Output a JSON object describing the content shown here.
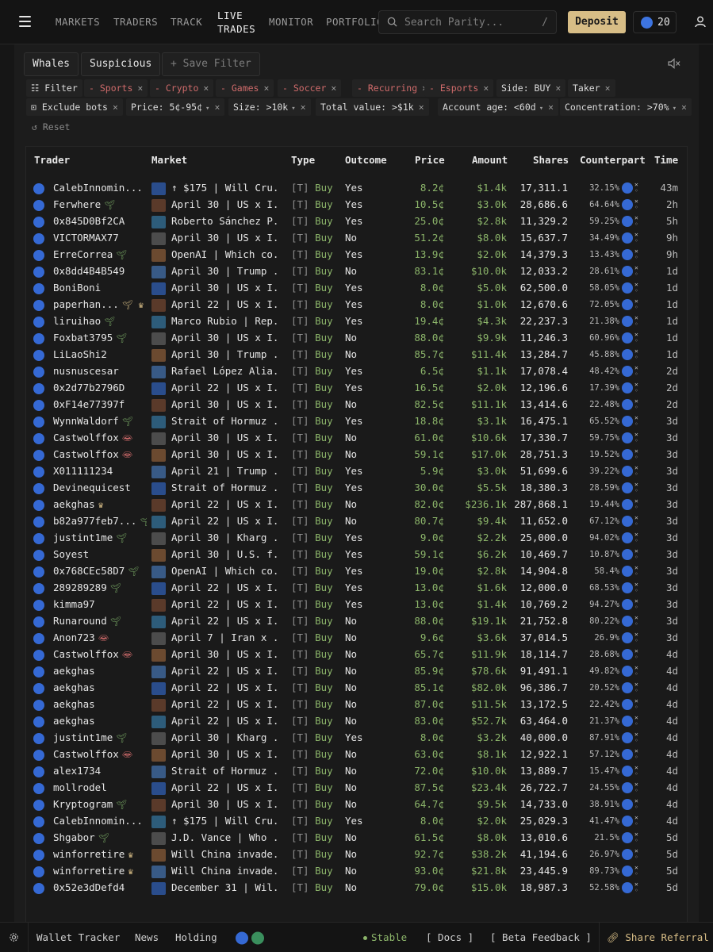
{
  "nav": {
    "links": [
      "MARKETS",
      "TRADERS",
      "TRACK",
      "LIVE TRADES",
      "MONITOR",
      "PORTFOLIO"
    ],
    "active": "LIVE TRADES",
    "search_placeholder": "Search Parity...",
    "search_shortcut": "/",
    "deposit_label": "Deposit",
    "points": "20"
  },
  "tabs": {
    "whales": "Whales",
    "suspicious": "Suspicious",
    "save_filter": "+ Save Filter"
  },
  "filters": {
    "filter_label": "Filter",
    "excluded": [
      "- Sports",
      "- Crypto",
      "- Games",
      "- Soccer",
      "- Recurring",
      "- Esports"
    ],
    "side": "Side: BUY",
    "taker": "Taker",
    "exclude_bots": "Exclude bots",
    "price": "Price: 5¢-95¢",
    "size": "Size: >10k",
    "total_value": "Total value: >$1k",
    "account_age": "Account age: <60d",
    "concentration": "Concentration: >70%",
    "reset": "Reset",
    "close_glyph": "×",
    "dropdown_glyph": "▾"
  },
  "columns": [
    "Trader",
    "Market",
    "Type",
    "Outcome",
    "Price",
    "Amount",
    "Shares",
    "Counterpart",
    "Time"
  ],
  "type_prefix": "[T]",
  "type_value": "Buy",
  "trades": [
    {
      "trader": "CalebInnomin...",
      "badge": "",
      "market": "↑ $175 | Will Cru...",
      "outcome": "Yes",
      "price": "8.2¢",
      "amount": "$1.4k",
      "shares": "17,311.1",
      "cp": "32.15%",
      "time": "43m"
    },
    {
      "trader": "Ferwhere",
      "badge": "sprout",
      "market": "April 30 | US x I...",
      "outcome": "Yes",
      "price": "10.5¢",
      "amount": "$3.0k",
      "shares": "28,686.6",
      "cp": "64.64%",
      "time": "2h"
    },
    {
      "trader": "0x845D0Bf2CA",
      "badge": "",
      "market": "Roberto Sánchez P...",
      "outcome": "Yes",
      "price": "25.0¢",
      "amount": "$2.8k",
      "shares": "11,329.2",
      "cp": "59.25%",
      "time": "5h"
    },
    {
      "trader": "VICTORMAX77",
      "badge": "",
      "market": "April 30 | US x I...",
      "outcome": "No",
      "price": "51.2¢",
      "amount": "$8.0k",
      "shares": "15,637.7",
      "cp": "34.49%",
      "time": "9h"
    },
    {
      "trader": "ErreCorrea",
      "badge": "sprout",
      "market": "OpenAI | Which co...",
      "outcome": "Yes",
      "price": "13.9¢",
      "amount": "$2.0k",
      "shares": "14,379.3",
      "cp": "13.43%",
      "time": "9h"
    },
    {
      "trader": "0x8dd4B4B549",
      "badge": "",
      "market": "April 30 | Trump ...",
      "outcome": "No",
      "price": "83.1¢",
      "amount": "$10.0k",
      "shares": "12,033.2",
      "cp": "28.61%",
      "time": "1d"
    },
    {
      "trader": "BoniBoni",
      "badge": "",
      "market": "April 30 | US x I...",
      "outcome": "Yes",
      "price": "8.0¢",
      "amount": "$5.0k",
      "shares": "62,500.0",
      "cp": "58.05%",
      "time": "1d"
    },
    {
      "trader": "paperhan...",
      "badge": "sprout-crown",
      "market": "April 22 | US x I...",
      "outcome": "Yes",
      "price": "8.0¢",
      "amount": "$1.0k",
      "shares": "12,670.6",
      "cp": "72.05%",
      "time": "1d"
    },
    {
      "trader": "liruihao",
      "badge": "sprout",
      "market": "Marco Rubio | Rep...",
      "outcome": "Yes",
      "price": "19.4¢",
      "amount": "$4.3k",
      "shares": "22,237.3",
      "cp": "21.38%",
      "time": "1d"
    },
    {
      "trader": "Foxbat3795",
      "badge": "sprout",
      "market": "April 30 | US x I...",
      "outcome": "No",
      "price": "88.0¢",
      "amount": "$9.9k",
      "shares": "11,246.3",
      "cp": "60.96%",
      "time": "1d"
    },
    {
      "trader": "LiLaoShi2",
      "badge": "",
      "market": "April 30 | Trump ...",
      "outcome": "No",
      "price": "85.7¢",
      "amount": "$11.4k",
      "shares": "13,284.7",
      "cp": "45.88%",
      "time": "1d"
    },
    {
      "trader": "nusnuscesar",
      "badge": "",
      "market": "Rafael López Alia...",
      "outcome": "Yes",
      "price": "6.5¢",
      "amount": "$1.1k",
      "shares": "17,078.4",
      "cp": "48.42%",
      "time": "2d"
    },
    {
      "trader": "0x2d77b2796D",
      "badge": "",
      "market": "April 22 | US x I...",
      "outcome": "Yes",
      "price": "16.5¢",
      "amount": "$2.0k",
      "shares": "12,196.6",
      "cp": "17.39%",
      "time": "2d"
    },
    {
      "trader": "0xF14e77397f",
      "badge": "",
      "market": "April 30 | US x I...",
      "outcome": "No",
      "price": "82.5¢",
      "amount": "$11.1k",
      "shares": "13,414.6",
      "cp": "22.48%",
      "time": "2d"
    },
    {
      "trader": "WynnWaldorf",
      "badge": "sprout",
      "market": "Strait of Hormuz ...",
      "outcome": "Yes",
      "price": "18.8¢",
      "amount": "$3.1k",
      "shares": "16,475.1",
      "cp": "65.52%",
      "time": "3d"
    },
    {
      "trader": "Castwolffox",
      "badge": "lips",
      "market": "April 30 | US x I...",
      "outcome": "No",
      "price": "61.0¢",
      "amount": "$10.6k",
      "shares": "17,330.7",
      "cp": "59.75%",
      "time": "3d"
    },
    {
      "trader": "Castwolffox",
      "badge": "lips",
      "market": "April 30 | US x I...",
      "outcome": "No",
      "price": "59.1¢",
      "amount": "$17.0k",
      "shares": "28,751.3",
      "cp": "19.52%",
      "time": "3d"
    },
    {
      "trader": "X011111234",
      "badge": "",
      "market": "April 21 | Trump ...",
      "outcome": "Yes",
      "price": "5.9¢",
      "amount": "$3.0k",
      "shares": "51,699.6",
      "cp": "39.22%",
      "time": "3d"
    },
    {
      "trader": "Devinequicest",
      "badge": "",
      "market": "Strait of Hormuz ...",
      "outcome": "Yes",
      "price": "30.0¢",
      "amount": "$5.5k",
      "shares": "18,380.3",
      "cp": "28.59%",
      "time": "3d"
    },
    {
      "trader": "aekghas",
      "badge": "crown",
      "market": "April 22 | US x I...",
      "outcome": "No",
      "price": "82.0¢",
      "amount": "$236.1k",
      "shares": "287,868.1",
      "cp": "19.44%",
      "time": "3d"
    },
    {
      "trader": "b82a977feb7...",
      "badge": "sprout",
      "market": "April 22 | US x I...",
      "outcome": "No",
      "price": "80.7¢",
      "amount": "$9.4k",
      "shares": "11,652.0",
      "cp": "67.12%",
      "time": "3d"
    },
    {
      "trader": "justint1me",
      "badge": "sprout",
      "market": "April 30 | Kharg ...",
      "outcome": "Yes",
      "price": "9.0¢",
      "amount": "$2.2k",
      "shares": "25,000.0",
      "cp": "94.02%",
      "time": "3d"
    },
    {
      "trader": "Soyest",
      "badge": "",
      "market": "April 30 | U.S. f...",
      "outcome": "Yes",
      "price": "59.1¢",
      "amount": "$6.2k",
      "shares": "10,469.7",
      "cp": "10.87%",
      "time": "3d"
    },
    {
      "trader": "0x768CEc58D7",
      "badge": "sprout",
      "market": "OpenAI | Which co...",
      "outcome": "Yes",
      "price": "19.0¢",
      "amount": "$2.8k",
      "shares": "14,904.8",
      "cp": "58.4%",
      "time": "3d"
    },
    {
      "trader": "289289289",
      "badge": "sprout",
      "market": "April 22 | US x I...",
      "outcome": "Yes",
      "price": "13.0¢",
      "amount": "$1.6k",
      "shares": "12,000.0",
      "cp": "68.53%",
      "time": "3d"
    },
    {
      "trader": "kimma97",
      "badge": "",
      "market": "April 22 | US x I...",
      "outcome": "Yes",
      "price": "13.0¢",
      "amount": "$1.4k",
      "shares": "10,769.2",
      "cp": "94.27%",
      "time": "3d"
    },
    {
      "trader": "Runaround",
      "badge": "sprout",
      "market": "April 22 | US x I...",
      "outcome": "No",
      "price": "88.0¢",
      "amount": "$19.1k",
      "shares": "21,752.8",
      "cp": "80.22%",
      "time": "3d"
    },
    {
      "trader": "Anon723",
      "badge": "lips",
      "market": "April 7 | Iran x ...",
      "outcome": "No",
      "price": "9.6¢",
      "amount": "$3.6k",
      "shares": "37,014.5",
      "cp": "26.9%",
      "time": "3d"
    },
    {
      "trader": "Castwolffox",
      "badge": "lips",
      "market": "April 30 | US x I...",
      "outcome": "No",
      "price": "65.7¢",
      "amount": "$11.9k",
      "shares": "18,114.7",
      "cp": "28.68%",
      "time": "4d"
    },
    {
      "trader": "aekghas",
      "badge": "",
      "market": "April 22 | US x I...",
      "outcome": "No",
      "price": "85.9¢",
      "amount": "$78.6k",
      "shares": "91,491.1",
      "cp": "49.82%",
      "time": "4d"
    },
    {
      "trader": "aekghas",
      "badge": "",
      "market": "April 22 | US x I...",
      "outcome": "No",
      "price": "85.1¢",
      "amount": "$82.0k",
      "shares": "96,386.7",
      "cp": "20.52%",
      "time": "4d"
    },
    {
      "trader": "aekghas",
      "badge": "",
      "market": "April 22 | US x I...",
      "outcome": "No",
      "price": "87.0¢",
      "amount": "$11.5k",
      "shares": "13,172.5",
      "cp": "22.42%",
      "time": "4d"
    },
    {
      "trader": "aekghas",
      "badge": "",
      "market": "April 22 | US x I...",
      "outcome": "No",
      "price": "83.0¢",
      "amount": "$52.7k",
      "shares": "63,464.0",
      "cp": "21.37%",
      "time": "4d"
    },
    {
      "trader": "justint1me",
      "badge": "sprout",
      "market": "April 30 | Kharg ...",
      "outcome": "Yes",
      "price": "8.0¢",
      "amount": "$3.2k",
      "shares": "40,000.0",
      "cp": "87.91%",
      "time": "4d"
    },
    {
      "trader": "Castwolffox",
      "badge": "lips",
      "market": "April 30 | US x I...",
      "outcome": "No",
      "price": "63.0¢",
      "amount": "$8.1k",
      "shares": "12,922.1",
      "cp": "57.12%",
      "time": "4d"
    },
    {
      "trader": "alex1734",
      "badge": "",
      "market": "Strait of Hormuz ...",
      "outcome": "No",
      "price": "72.0¢",
      "amount": "$10.0k",
      "shares": "13,889.7",
      "cp": "15.47%",
      "time": "4d"
    },
    {
      "trader": "mollrodel",
      "badge": "",
      "market": "April 22 | US x I...",
      "outcome": "No",
      "price": "87.5¢",
      "amount": "$23.4k",
      "shares": "26,722.7",
      "cp": "24.55%",
      "time": "4d"
    },
    {
      "trader": "Kryptogram",
      "badge": "sprout",
      "market": "April 30 | US x I...",
      "outcome": "No",
      "price": "64.7¢",
      "amount": "$9.5k",
      "shares": "14,733.0",
      "cp": "38.91%",
      "time": "4d"
    },
    {
      "trader": "CalebInnomin...",
      "badge": "",
      "market": "↑ $175 | Will Cru...",
      "outcome": "Yes",
      "price": "8.0¢",
      "amount": "$2.0k",
      "shares": "25,029.3",
      "cp": "41.47%",
      "time": "4d"
    },
    {
      "trader": "Shgabor",
      "badge": "sprout",
      "market": "J.D. Vance | Who ...",
      "outcome": "No",
      "price": "61.5¢",
      "amount": "$8.0k",
      "shares": "13,010.6",
      "cp": "21.5%",
      "time": "5d"
    },
    {
      "trader": "winforretire",
      "badge": "crown",
      "market": "Will China invade...",
      "outcome": "No",
      "price": "92.7¢",
      "amount": "$38.2k",
      "shares": "41,194.6",
      "cp": "26.97%",
      "time": "5d"
    },
    {
      "trader": "winforretire",
      "badge": "crown",
      "market": "Will China invade...",
      "outcome": "No",
      "price": "93.0¢",
      "amount": "$21.8k",
      "shares": "23,445.9",
      "cp": "89.73%",
      "time": "5d"
    },
    {
      "trader": "0x52e3dDefd4",
      "badge": "",
      "market": "December 31 | Wil...",
      "outcome": "No",
      "price": "79.0¢",
      "amount": "$15.0k",
      "shares": "18,987.3",
      "cp": "52.58%",
      "time": "5d"
    }
  ],
  "bottom": {
    "wallet_tracker": "Wallet Tracker",
    "news": "News",
    "holding": "Holding",
    "stable": "Stable",
    "docs": "[ Docs ]",
    "beta": "[ Beta Feedback ]",
    "share": "Share Referral"
  },
  "colors": {
    "accent": "#d7bd86",
    "positive": "#8cb56a",
    "negative": "#d06b6b",
    "avatar": "#3569d4"
  }
}
